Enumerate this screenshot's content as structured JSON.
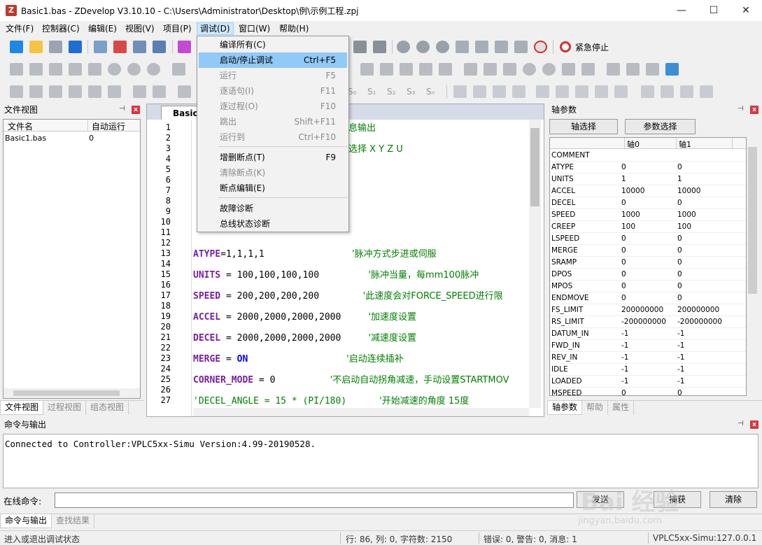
{
  "window": {
    "title": "Basic1.bas - ZDevelop V3.10.10 - C:\\Users\\Administrator\\Desktop\\例\\示例工程.zpj",
    "app_icon_glyph": "Z",
    "minimize_glyph": "—",
    "maximize_glyph": "☐",
    "close_glyph": "✕"
  },
  "menubar": [
    "文件(F)",
    "控制器(C)",
    "编辑(E)",
    "视图(V)",
    "项目(P)",
    "调试(D)",
    "窗口(W)",
    "帮助(H)"
  ],
  "toolbar": {
    "emergency_stop_label": "紧急停止",
    "row3_glyphs": [
      "S₀",
      "S₁",
      "S₂",
      "S₃",
      "Sₙ"
    ]
  },
  "debug_menu": {
    "items": [
      {
        "label": "编译所有(C)",
        "shortcut": "",
        "enabled": true
      },
      {
        "label": "启动/停止调试",
        "shortcut": "Ctrl+F5",
        "enabled": true,
        "highlighted": true
      },
      {
        "label": "运行",
        "shortcut": "F5",
        "enabled": false
      },
      {
        "label": "逐语句(I)",
        "shortcut": "F11",
        "enabled": false
      },
      {
        "label": "逐过程(O)",
        "shortcut": "F10",
        "enabled": false
      },
      {
        "label": "跳出",
        "shortcut": "Shift+F11",
        "enabled": false
      },
      {
        "label": "运行到",
        "shortcut": "Ctrl+F10",
        "enabled": false
      },
      {
        "label": "增删断点(T)",
        "shortcut": "F9",
        "enabled": true
      },
      {
        "label": "清除断点(K)",
        "shortcut": "",
        "enabled": false
      },
      {
        "label": "断点编辑(E)",
        "shortcut": "",
        "enabled": true
      },
      {
        "label": "故障诊断",
        "shortcut": "",
        "enabled": true
      },
      {
        "label": "总线状态诊断",
        "shortcut": "",
        "enabled": true
      }
    ]
  },
  "file_view": {
    "title": "文件视图",
    "pin_glyph": "⊣",
    "columns": [
      "文件名",
      "自动运行"
    ],
    "rows": [
      {
        "name": "Basic1.bas",
        "auto": "0"
      }
    ],
    "tabs": [
      "文件视图",
      "过程视图",
      "组态视图"
    ]
  },
  "editor": {
    "tab_label": "Basic1.",
    "line_numbers": [
      "1",
      "2",
      "3",
      "4",
      "5",
      "6",
      "7",
      "8",
      "9",
      "10",
      "11",
      "12",
      "13",
      "14",
      "15",
      "16",
      "17",
      "18",
      "19",
      "20",
      "21",
      "22",
      "23",
      "24",
      "25",
      "26",
      "27"
    ],
    "code_lines": [
      {
        "text": "",
        "comment": "息输出",
        "line": 1
      },
      {
        "text": "",
        "comment": "选择 X Y Z U",
        "line": 3
      },
      {
        "text": "",
        "comment": "",
        "line": 5
      },
      {
        "text": "",
        "comment": "",
        "line": 7
      },
      {
        "text": "",
        "comment": "",
        "line": 11
      },
      {
        "kw": "ATYPE",
        "text": "=1,1,1,1",
        "pad": "                ",
        "comment": "'脉冲方式步进或伺服",
        "line": 13
      },
      {
        "kw": "UNITS",
        "text": " = 100,100,100,100",
        "pad": "         ",
        "comment": "'脉冲当量，每mm100脉冲",
        "line": 15
      },
      {
        "kw": "SPEED",
        "text": " = 200,200,200,200",
        "pad": "        ",
        "comment": "'此速度会对FORCE_SPEED进行限",
        "line": 17
      },
      {
        "kw": "ACCEL",
        "text": " = 2000,2000,2000,2000",
        "pad": "     ",
        "comment": "'加速度设置",
        "line": 19
      },
      {
        "kw": "DECEL",
        "text": " = 2000,2000,2000,2000",
        "pad": "     ",
        "comment": "'减速度设置",
        "line": 21
      },
      {
        "kw": "MERGE",
        "text": " = ",
        "kb": "ON",
        "pad": "                  ",
        "comment": "'启动连续插补",
        "line": 23
      },
      {
        "kw": "CORNER_MODE",
        "text": " = 0",
        "pad": "          ",
        "comment": "'不启动自动拐角减速，手动设置STARTMOV",
        "line": 25
      },
      {
        "kw": "",
        "text": "'DECEL_ANGLE = 15 * (PI/180)",
        "pad": "      ",
        "comment": "'开始减速的角度 15度",
        "line": 27
      }
    ]
  },
  "axis_panel": {
    "title": "轴参数",
    "buttons": [
      "轴选择",
      "参数选择"
    ],
    "columns": [
      "",
      "轴0",
      "轴1"
    ],
    "rows": [
      [
        "COMMENT",
        "",
        ""
      ],
      [
        "ATYPE",
        "0",
        "0"
      ],
      [
        "UNITS",
        "1",
        "1"
      ],
      [
        "ACCEL",
        "10000",
        "10000"
      ],
      [
        "DECEL",
        "0",
        "0"
      ],
      [
        "SPEED",
        "1000",
        "1000"
      ],
      [
        "CREEP",
        "100",
        "100"
      ],
      [
        "LSPEED",
        "0",
        "0"
      ],
      [
        "MERGE",
        "0",
        "0"
      ],
      [
        "SRAMP",
        "0",
        "0"
      ],
      [
        "DPOS",
        "0",
        "0"
      ],
      [
        "MPOS",
        "0",
        "0"
      ],
      [
        "ENDMOVE",
        "0",
        "0"
      ],
      [
        "FS_LIMIT",
        "200000000",
        "200000000"
      ],
      [
        "RS_LIMIT",
        "-200000000",
        "-200000000"
      ],
      [
        "DATUM_IN",
        "-1",
        "-1"
      ],
      [
        "FWD_IN",
        "-1",
        "-1"
      ],
      [
        "REV_IN",
        "-1",
        "-1"
      ],
      [
        "IDLE",
        "-1",
        "-1"
      ],
      [
        "LOADED",
        "-1",
        "-1"
      ],
      [
        "MSPEED",
        "0",
        "0"
      ]
    ],
    "tabs": [
      "轴参数",
      "帮助",
      "属性"
    ]
  },
  "command_panel": {
    "title": "命令与输出",
    "output": "Connected to Controller:VPLC5xx-Simu Version:4.99-20190528.",
    "input_label": "在线命令:",
    "input_value": "",
    "send_label": "发送",
    "capture_label": "捕获",
    "clear_label": "清除",
    "tabs": [
      "命令与输出",
      "查找结果"
    ]
  },
  "statusbar": {
    "message": "进入或退出调试状态",
    "cursor": "行: 86, 列: 0, 字符数: 2150",
    "diagnostics": "错误: 0, 警告: 0, 消息: 1",
    "connection": "VPLC5xx-Simu:127.0.0.1"
  },
  "watermark": {
    "text": "Bai 经验",
    "url_text": "jingyan.baidu.com"
  }
}
